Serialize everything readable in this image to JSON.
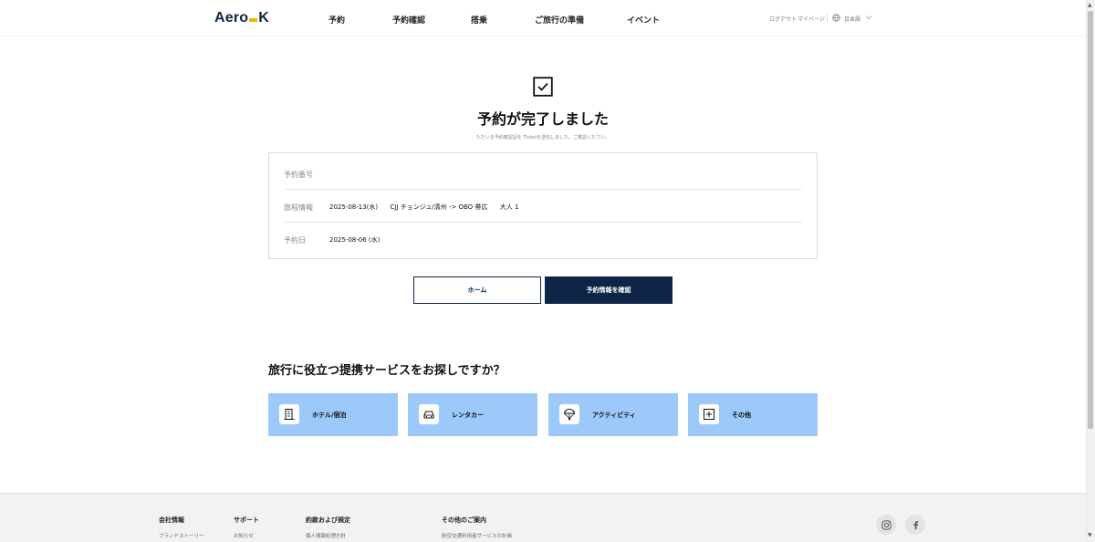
{
  "header": {
    "logo_left": "Aero",
    "logo_right": "K",
    "nav": [
      "予約",
      "予約確認",
      "搭乗",
      "ご旅行の準備",
      "イベント"
    ],
    "utility": {
      "logout": "ログアウト",
      "mypage": "マイページ",
      "language": "日本語"
    }
  },
  "main": {
    "title": "予約が完了しました",
    "subtitle": "ただいま予約確認証を Ticketを送信しました。ご確認ください。",
    "details": [
      {
        "label": "予約番号",
        "value": ""
      },
      {
        "label": "旅程情報",
        "value": "2025-08-13(水)      CJJ チョンジュ/清州 -> OBO 帯広      大人 1"
      },
      {
        "label": "予約日",
        "value": "2025-08-06 (水)"
      }
    ],
    "buttons": {
      "home": "ホーム",
      "confirm": "予約情報を確認"
    }
  },
  "partners": {
    "title": "旅行に役立つ提携サービスをお探しですか？",
    "cards": [
      {
        "label": "ホテル/宿泊",
        "icon": "hotel-icon"
      },
      {
        "label": "レンタカー",
        "icon": "car-icon"
      },
      {
        "label": "アクティビティ",
        "icon": "parachute-icon"
      },
      {
        "label": "その他",
        "icon": "plus-box-icon"
      }
    ]
  },
  "footer": {
    "columns": [
      {
        "heading": "会社情報",
        "item": "ブランドストーリー"
      },
      {
        "heading": "サポート",
        "item": "お知らせ"
      },
      {
        "heading": "約款および規定",
        "item": "個人情報処理方針"
      },
      {
        "heading": "その他のご案内",
        "item": "航空交通利用者サービスの計画"
      }
    ],
    "social": [
      "instagram-icon",
      "facebook-icon"
    ]
  },
  "colors": {
    "navy": "#0f2547",
    "card_blue": "#9cc8fa",
    "logo_accent": "#f4b400"
  }
}
